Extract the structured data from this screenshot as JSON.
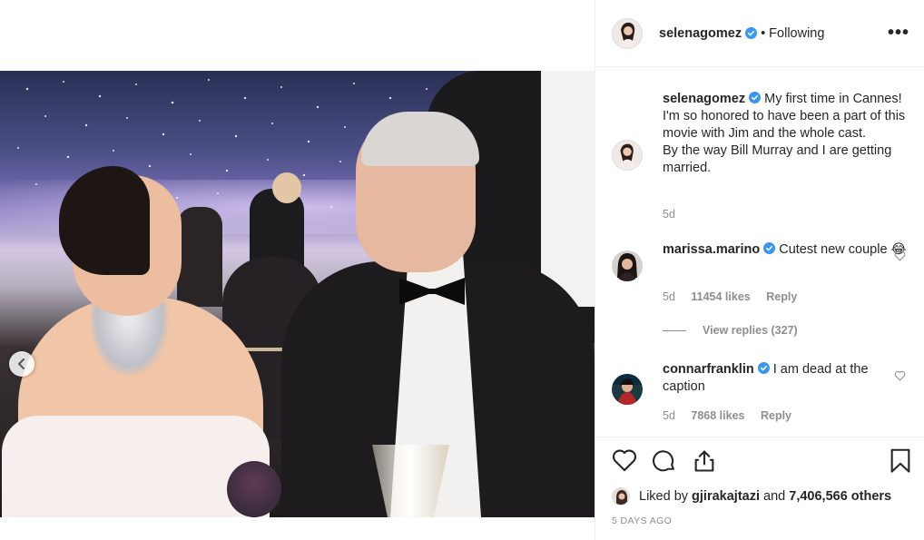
{
  "post": {
    "username": "selenagomez",
    "follow_state": "• Following",
    "more_label": "•••"
  },
  "caption": {
    "username": "selenagomez",
    "text": "My first time in Cannes! I'm so honored to have been a part of this movie with Jim and the whole cast.",
    "text2": "By the way Bill Murray and I are getting married.",
    "time": "5d"
  },
  "comments": [
    {
      "username": "marissa.marino",
      "text": "Cutest new couple 😂",
      "time": "5d",
      "likes": "11454 likes",
      "reply": "Reply"
    },
    {
      "username": "connarfranklin",
      "text": "I am dead at the caption",
      "time": "5d",
      "likes": "7868 likes",
      "reply": "Reply"
    }
  ],
  "view_replies": "View replies (327)",
  "likes": {
    "prefix": "Liked by",
    "user": "gjirakajtazi",
    "mid": "and",
    "count": "7,406,566 others"
  },
  "posted": "5 DAYS AGO",
  "colors": {
    "verified": "#3897f0",
    "muted": "#8e8e8e",
    "text": "#262626"
  },
  "icons": [
    "chevron-left-icon",
    "heart-icon",
    "comment-icon",
    "share-icon",
    "bookmark-icon",
    "verified-icon",
    "more-icon"
  ]
}
